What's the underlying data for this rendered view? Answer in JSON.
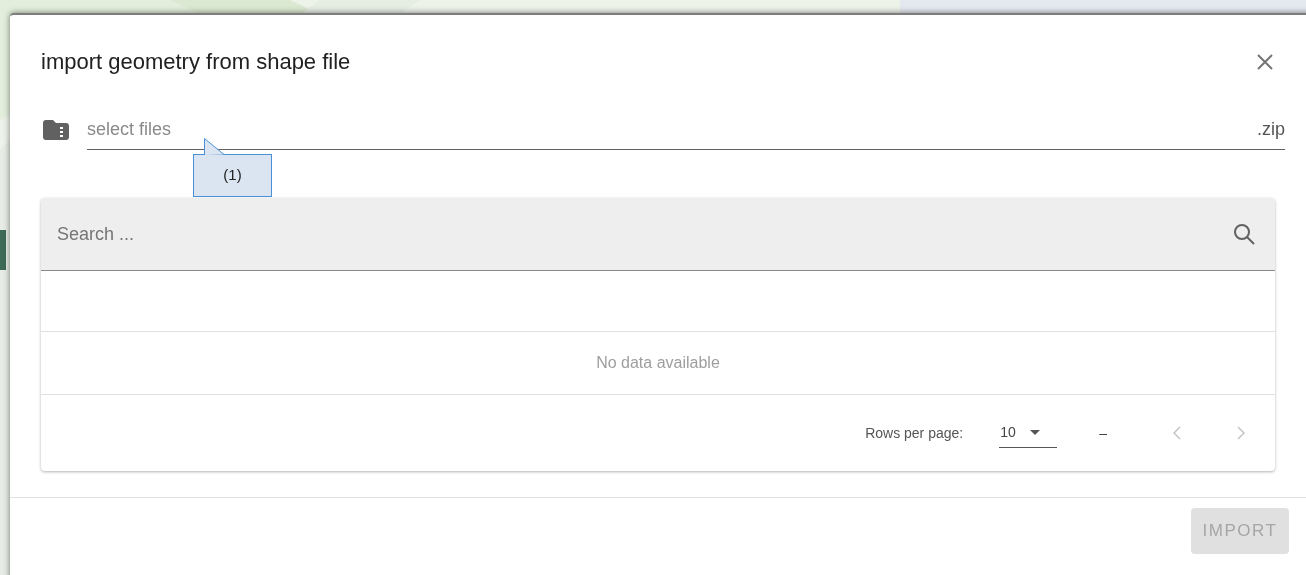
{
  "dialog": {
    "title": "import geometry from shape file"
  },
  "file_field": {
    "placeholder": "select files",
    "suffix": ".zip"
  },
  "callout": {
    "text": "(1)"
  },
  "table": {
    "search": {
      "placeholder": "Search ..."
    },
    "empty_message": "No data available",
    "footer": {
      "rows_per_page_label": "Rows per page:",
      "rows_per_page": "10",
      "range": "–",
      "prev_disabled": true,
      "next_disabled": true
    }
  },
  "actions": [
    {
      "label": "IMPORT",
      "disabled": true
    }
  ]
}
